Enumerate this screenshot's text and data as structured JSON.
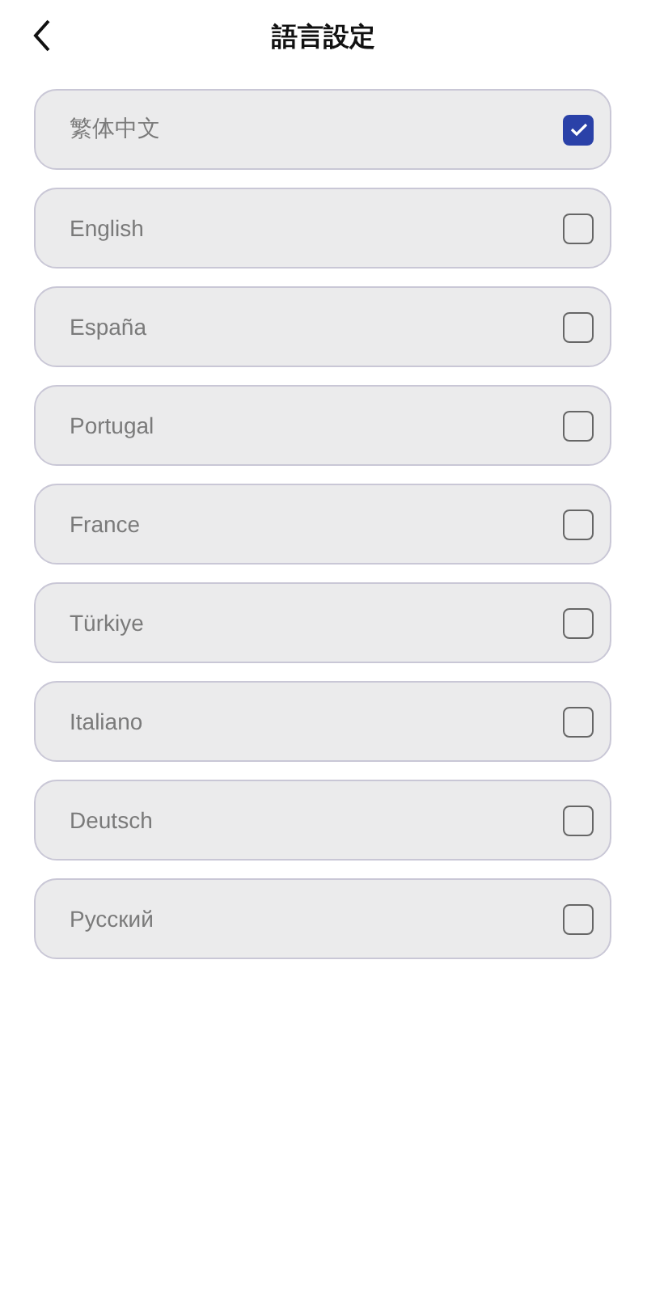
{
  "header": {
    "title": "語言設定"
  },
  "languages": [
    {
      "label": "繁体中文",
      "selected": true
    },
    {
      "label": "English",
      "selected": false
    },
    {
      "label": "España",
      "selected": false
    },
    {
      "label": "Portugal",
      "selected": false
    },
    {
      "label": "France",
      "selected": false
    },
    {
      "label": "Türkiye",
      "selected": false
    },
    {
      "label": "Italiano",
      "selected": false
    },
    {
      "label": "Deutsch",
      "selected": false
    },
    {
      "label": "Русский",
      "selected": false
    }
  ]
}
